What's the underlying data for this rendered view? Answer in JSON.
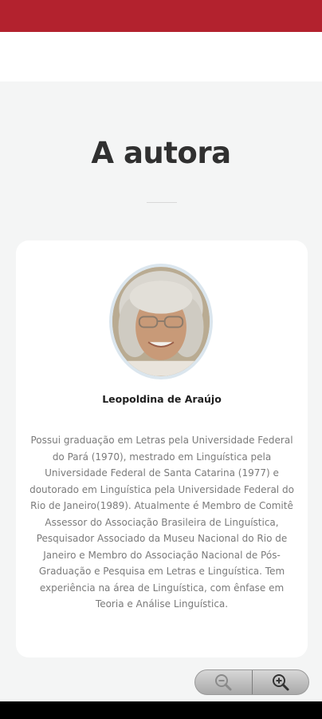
{
  "colors": {
    "top_bar": "#b3222e",
    "background": "#f4f5f5",
    "card": "#ffffff",
    "title": "#303030",
    "bio_text": "#7a7a7a"
  },
  "section": {
    "title": "A autora"
  },
  "author": {
    "name": "Leopoldina de Araújo",
    "bio": "Possui graduação em Letras pela Universidade Federal do Pará (1970), mestrado em Linguística pela Universidade Federal de Santa Catarina (1977) e doutorado em Linguística pela Universidade Federal do Rio de Janeiro(1989). Atualmente é Membro de Comitê Assessor do Associação Brasileira de Linguística, Pesquisador Associado da Museu Nacional do Rio de Janeiro e Membro do Associação Nacional de Pós-Graduação e Pesquisa em Letras e Linguística. Tem experiência na área de Linguística, com ênfase em Teoria e Análise Linguística."
  },
  "zoom": {
    "zoom_out_icon": "zoom-out-icon",
    "zoom_in_icon": "zoom-in-icon"
  }
}
